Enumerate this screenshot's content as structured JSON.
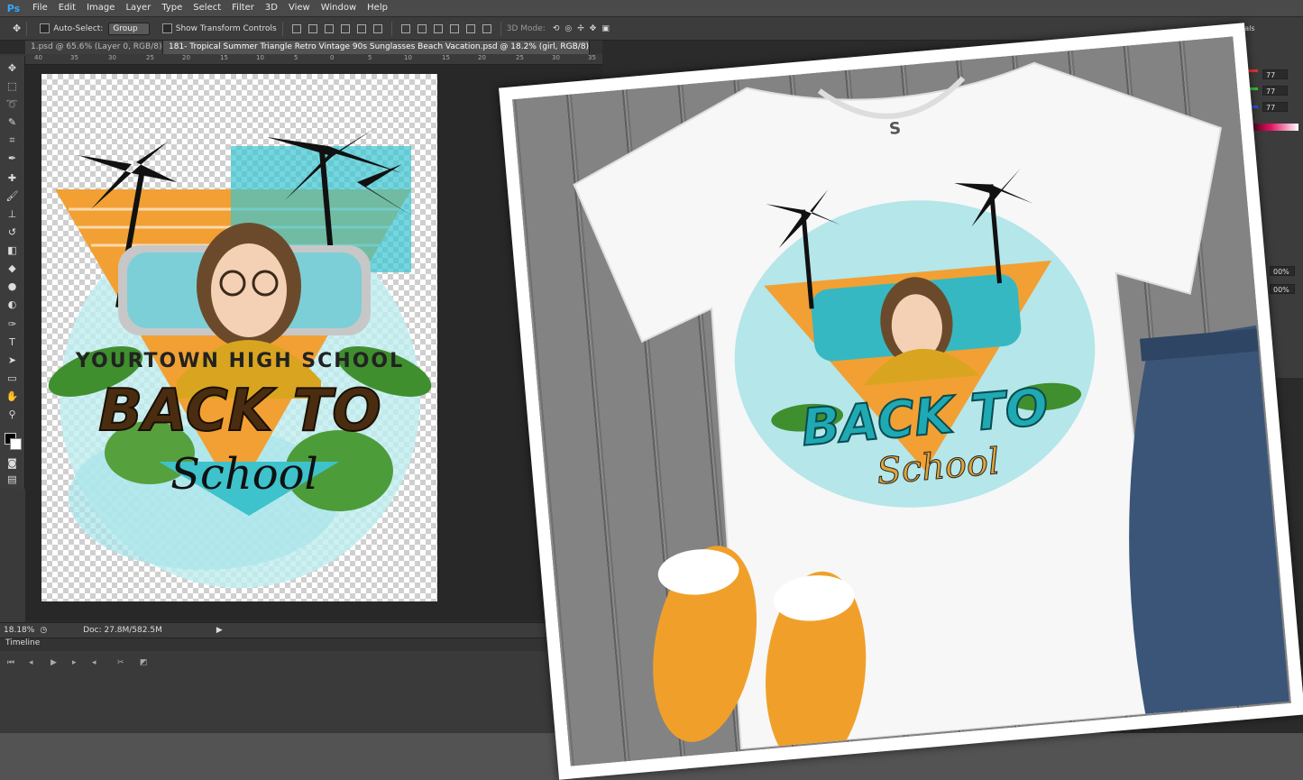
{
  "app": {
    "logo": "Ps",
    "menu": [
      "File",
      "Edit",
      "Image",
      "Layer",
      "Type",
      "Select",
      "Filter",
      "3D",
      "View",
      "Window",
      "Help"
    ]
  },
  "options_bar": {
    "auto_select_label": "Auto-Select:",
    "auto_select_value": "Group",
    "transform_label": "Show Transform Controls",
    "mode_label": "3D Mode:",
    "right_value": "ials"
  },
  "tabs": [
    {
      "label": "1.psd @ 65.6% (Layer 0, RGB/8)",
      "active": false
    },
    {
      "label": "181- Tropical Summer Triangle Retro Vintage 90s Sunglasses Beach Vacation.psd @ 18.2% (girl, RGB/8)",
      "active": true
    }
  ],
  "ruler_ticks": [
    "40",
    "35",
    "30",
    "25",
    "20",
    "15",
    "10",
    "5",
    "0",
    "5",
    "10",
    "15",
    "20",
    "25",
    "30",
    "35"
  ],
  "status": {
    "zoom": "18.18%",
    "doc": "Doc: 27.8M/582.5M"
  },
  "timeline": {
    "label": "Timeline"
  },
  "right_panel": {
    "values": [
      "77",
      "77",
      "77"
    ],
    "percent_1": "00%",
    "percent_2": "00%"
  },
  "design": {
    "school_text": "YOURTOWN HIGH SCHOOL",
    "back_to_text": "BACK TO",
    "school_script": "School",
    "shirt_label": "S"
  },
  "colors": {
    "accent": "#31a8ff",
    "teal": "#29b7c0",
    "orange": "#f2a033",
    "brown": "#4a2c10",
    "sneaker": "#f0a02a",
    "denim": "#3a5578"
  },
  "icons": {
    "tools": [
      "move-icon",
      "marquee-icon",
      "lasso-icon",
      "quick-select-icon",
      "crop-icon",
      "eyedropper-icon",
      "healing-icon",
      "brush-icon",
      "stamp-icon",
      "history-brush-icon",
      "eraser-icon",
      "paint-bucket-icon",
      "blur-icon",
      "dodge-icon",
      "pen-icon",
      "type-icon",
      "path-select-icon",
      "shape-icon",
      "hand-icon",
      "zoom-icon"
    ]
  }
}
